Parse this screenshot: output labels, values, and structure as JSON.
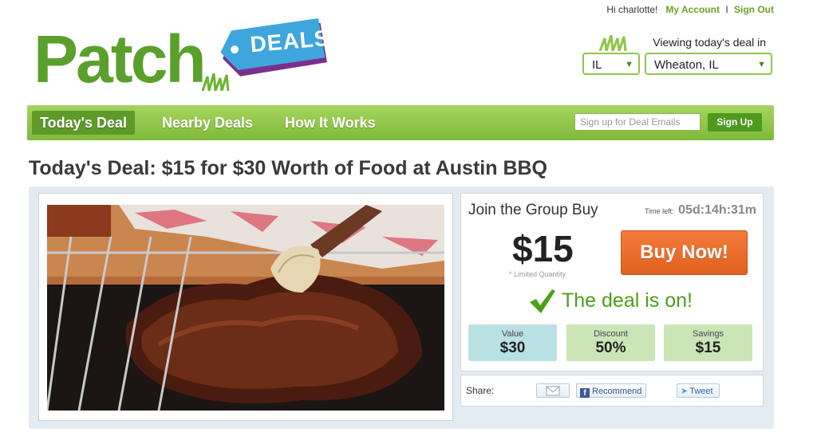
{
  "header": {
    "greeting": "Hi charlotte!",
    "my_account": "My Account",
    "separator": "I",
    "sign_out": "Sign Out"
  },
  "logo": {
    "word": "Patch",
    "tag": "DEALS"
  },
  "location": {
    "label": "Viewing today's deal in",
    "state": "IL",
    "city": "Wheaton, IL"
  },
  "nav": {
    "items": [
      {
        "label": "Today's Deal",
        "active": true
      },
      {
        "label": "Nearby Deals",
        "active": false
      },
      {
        "label": "How It Works",
        "active": false
      }
    ],
    "email_placeholder": "Sign up for Deal Emails",
    "signup_label": "Sign Up"
  },
  "deal": {
    "title": "Today's Deal: $15 for $30 Worth of Food at Austin BBQ",
    "join_label": "Join the Group Buy",
    "time_left_label": "Time left:",
    "time_left": "05d:14h:31m",
    "price": "$15",
    "limited": "* Limited Quantity",
    "buy_label": "Buy Now!",
    "status": "The deal is on!",
    "stats": {
      "value_label": "Value",
      "value": "$30",
      "discount_label": "Discount",
      "discount": "50%",
      "savings_label": "Savings",
      "savings": "$15"
    }
  },
  "share": {
    "label": "Share:",
    "recommend": "Recommend",
    "tweet": "Tweet"
  },
  "colors": {
    "brand_green": "#5aa02c",
    "nav_green": "#8cc548",
    "buy_orange": "#ed6f2c",
    "deal_blue": "#3ea6dc"
  }
}
